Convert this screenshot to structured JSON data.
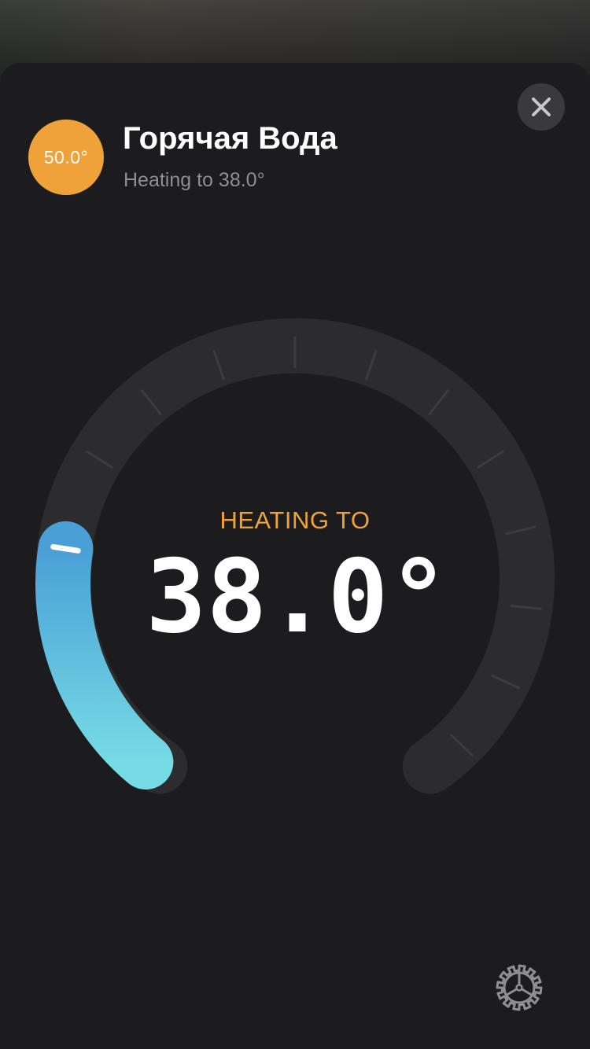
{
  "accessory": {
    "current_temperature": "50.0°",
    "name": "Горячая Вода",
    "status": "Heating to 38.0°"
  },
  "thermostat": {
    "mode_label": "HEATING TO",
    "target_display": "38.0°",
    "target_fill_fraction": 0.21
  },
  "colors": {
    "heating_accent": "#f0a23a",
    "dial_fill_start": "#4aa0d6",
    "dial_fill_end": "#76dbe5",
    "dial_track": "#2c2c2e",
    "sheet_background": "#1c1c1e"
  },
  "icons": {
    "close": "close-icon",
    "settings": "gear-icon"
  }
}
